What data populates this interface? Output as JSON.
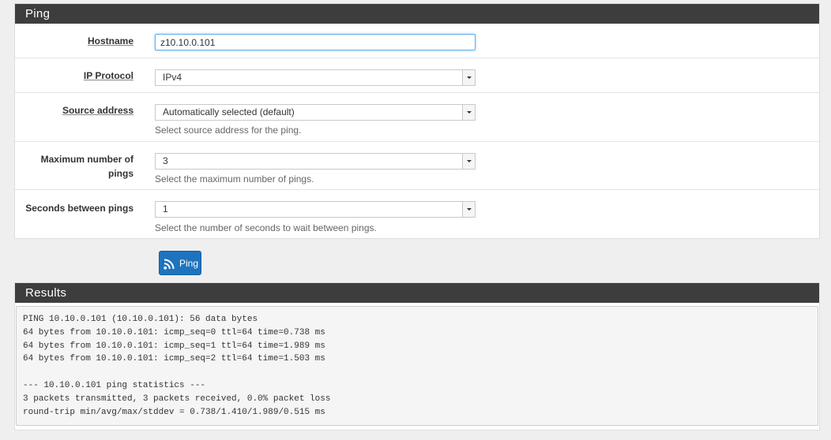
{
  "ping_panel": {
    "title": "Ping",
    "hostname": {
      "label": "Hostname",
      "value": "z10.10.0.101"
    },
    "ip_protocol": {
      "label": "IP Protocol",
      "selected": "IPv4"
    },
    "source_address": {
      "label": "Source address",
      "selected": "Automatically selected (default)",
      "help": "Select source address for the ping."
    },
    "max_pings": {
      "label_line1": "Maximum number of",
      "label_line2": "pings",
      "selected": "3",
      "help": "Select the maximum number of pings."
    },
    "seconds_between": {
      "label": "Seconds between pings",
      "selected": "1",
      "help": "Select the number of seconds to wait between pings."
    }
  },
  "ping_button": {
    "label": "Ping",
    "icon": "rss-icon"
  },
  "results_panel": {
    "title": "Results",
    "output": "PING 10.10.0.101 (10.10.0.101): 56 data bytes\n64 bytes from 10.10.0.101: icmp_seq=0 ttl=64 time=0.738 ms\n64 bytes from 10.10.0.101: icmp_seq=1 ttl=64 time=1.989 ms\n64 bytes from 10.10.0.101: icmp_seq=2 ttl=64 time=1.503 ms\n\n--- 10.10.0.101 ping statistics ---\n3 packets transmitted, 3 packets received, 0.0% packet loss\nround-trip min/avg/max/stddev = 0.738/1.410/1.989/0.515 ms"
  },
  "colors": {
    "heading_bg": "#3d3d3d",
    "button_bg": "#1e73be",
    "focus_border": "#66afe9"
  }
}
